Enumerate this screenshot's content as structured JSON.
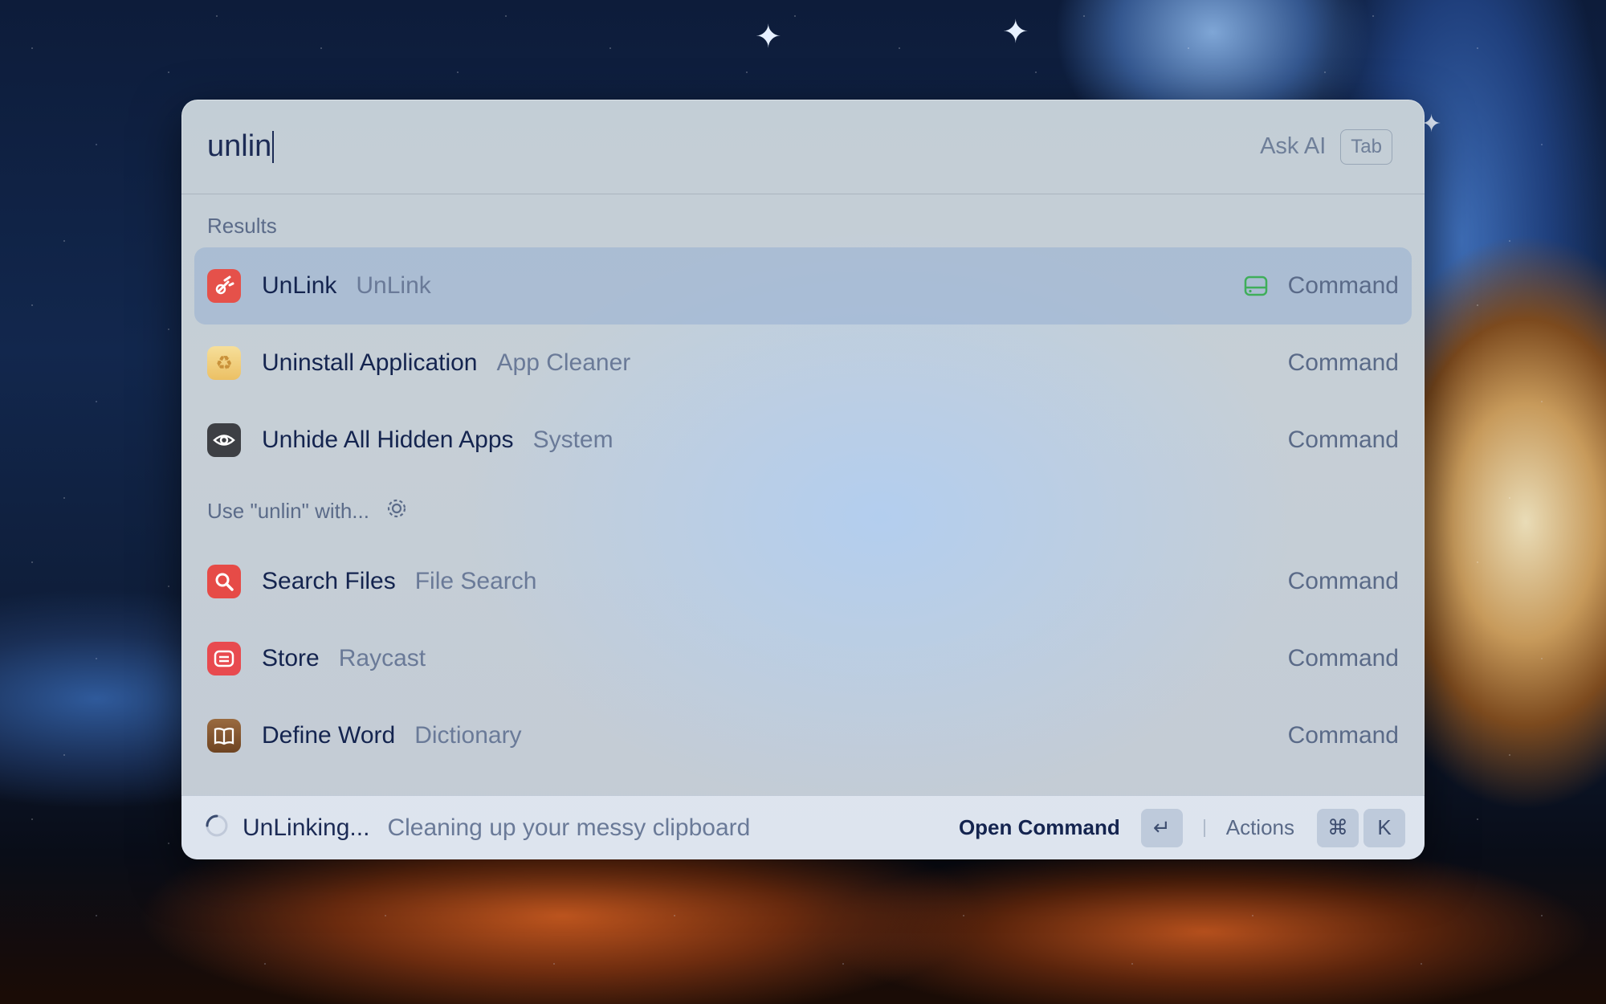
{
  "search": {
    "value": "unlin",
    "ask_ai_label": "Ask AI",
    "ask_ai_key": "Tab"
  },
  "sections": {
    "results": "Results",
    "fallback": "Use \"unlin\" with..."
  },
  "results": [
    {
      "title": "UnLink",
      "subtitle": "UnLink",
      "kind": "Command",
      "icon": "unlink-app-icon",
      "color": "#e5514a",
      "selected": true
    },
    {
      "title": "Uninstall Application",
      "subtitle": "App Cleaner",
      "kind": "Command",
      "icon": "app-cleaner-icon",
      "color": "#f0c866"
    },
    {
      "title": "Unhide All Hidden Apps",
      "subtitle": "System",
      "kind": "Command",
      "icon": "eye-icon",
      "color": "#3d3f44"
    }
  ],
  "fallbacks": [
    {
      "title": "Search Files",
      "subtitle": "File Search",
      "kind": "Command",
      "icon": "search-files-icon",
      "color": "#e64b47"
    },
    {
      "title": "Store",
      "subtitle": "Raycast",
      "kind": "Command",
      "icon": "store-icon",
      "color": "#e84a4f"
    },
    {
      "title": "Define Word",
      "subtitle": "Dictionary",
      "kind": "Command",
      "icon": "dictionary-icon",
      "color": "#8a5a33"
    }
  ],
  "footer": {
    "status": "UnLinking...",
    "description": "Cleaning up your messy clipboard",
    "primary_action": "Open Command",
    "primary_key": "↵",
    "actions_label": "Actions",
    "actions_keys": [
      "⌘",
      "K"
    ]
  }
}
